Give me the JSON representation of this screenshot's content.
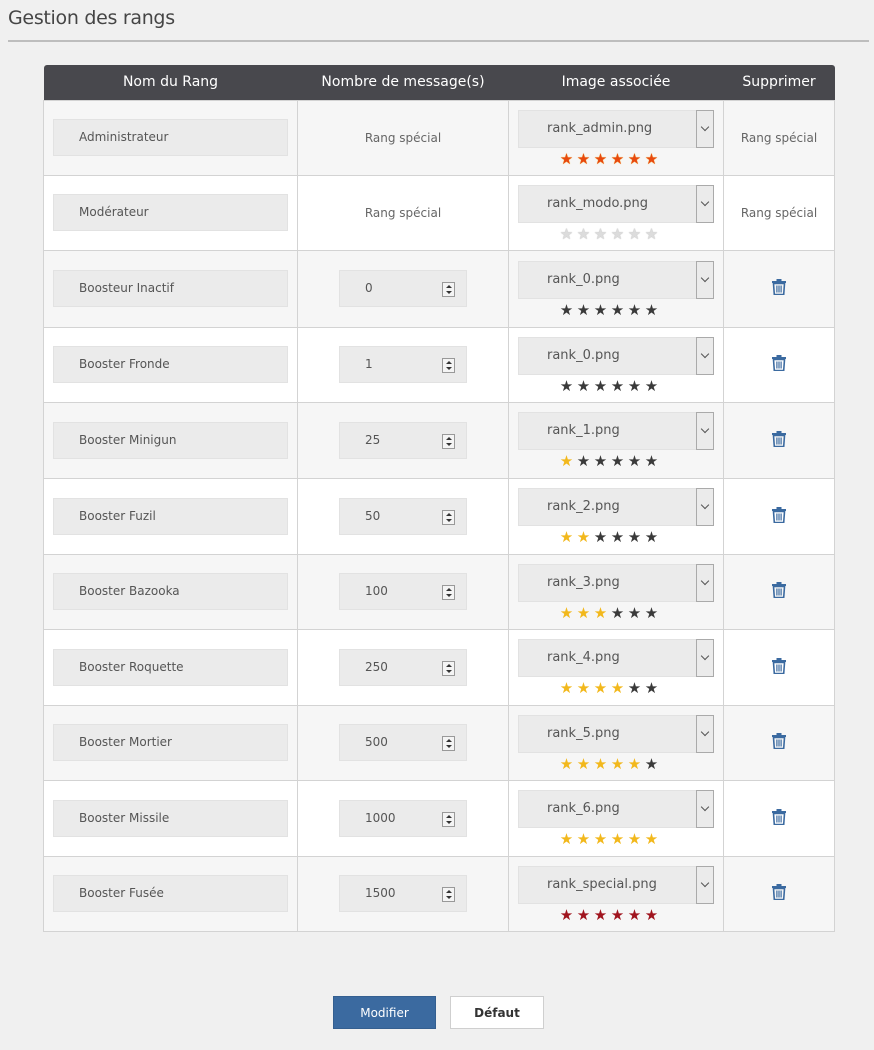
{
  "page": {
    "title": "Gestion des rangs"
  },
  "table": {
    "headers": [
      "Nom du Rang",
      "Nombre de message(s)",
      "Image associée",
      "Supprimer"
    ],
    "rows": [
      {
        "name": "Administrateur",
        "messages": "Rang spécial",
        "image": "rank_admin.png",
        "stars": "admin",
        "delete": "Rang spécial"
      },
      {
        "name": "Modérateur",
        "messages": "Rang spécial",
        "image": "rank_modo.png",
        "stars": "modo",
        "delete": "Rang spécial"
      },
      {
        "name": "Boosteur Inactif",
        "messages": "0",
        "image": "rank_0.png",
        "stars": "rank0",
        "delete": "trash-icon"
      },
      {
        "name": "Booster Fronde",
        "messages": "1",
        "image": "rank_0.png",
        "stars": "rank0",
        "delete": "trash-icon"
      },
      {
        "name": "Booster Minigun",
        "messages": "25",
        "image": "rank_1.png",
        "stars": "gold1",
        "delete": "trash-icon"
      },
      {
        "name": "Booster Fuzil",
        "messages": "50",
        "image": "rank_2.png",
        "stars": "gold2",
        "delete": "trash-icon"
      },
      {
        "name": "Booster Bazooka",
        "messages": "100",
        "image": "rank_3.png",
        "stars": "gold3",
        "delete": "trash-icon"
      },
      {
        "name": "Booster Roquette",
        "messages": "250",
        "image": "rank_4.png",
        "stars": "gold4",
        "delete": "trash-icon"
      },
      {
        "name": "Booster Mortier",
        "messages": "500",
        "image": "rank_5.png",
        "stars": "gold5",
        "delete": "trash-icon"
      },
      {
        "name": "Booster Missile",
        "messages": "1000",
        "image": "rank_6.png",
        "stars": "gold6",
        "delete": "trash-icon"
      },
      {
        "name": "Booster Fusée",
        "messages": "1500",
        "image": "rank_special.png",
        "stars": "special",
        "delete": "trash-icon"
      }
    ]
  },
  "buttons": {
    "modify": "Modifier",
    "default": "Défaut"
  },
  "colors": {
    "header_bg": "#48484d",
    "primary_button": "#3b6aa0",
    "star_gold": "#f2b81c",
    "star_orange": "#e8490f",
    "star_dark": "#3a3a3a",
    "star_white": "#dcdcdc",
    "star_red": "#a0141e",
    "trash_icon": "#3b6aa0"
  }
}
